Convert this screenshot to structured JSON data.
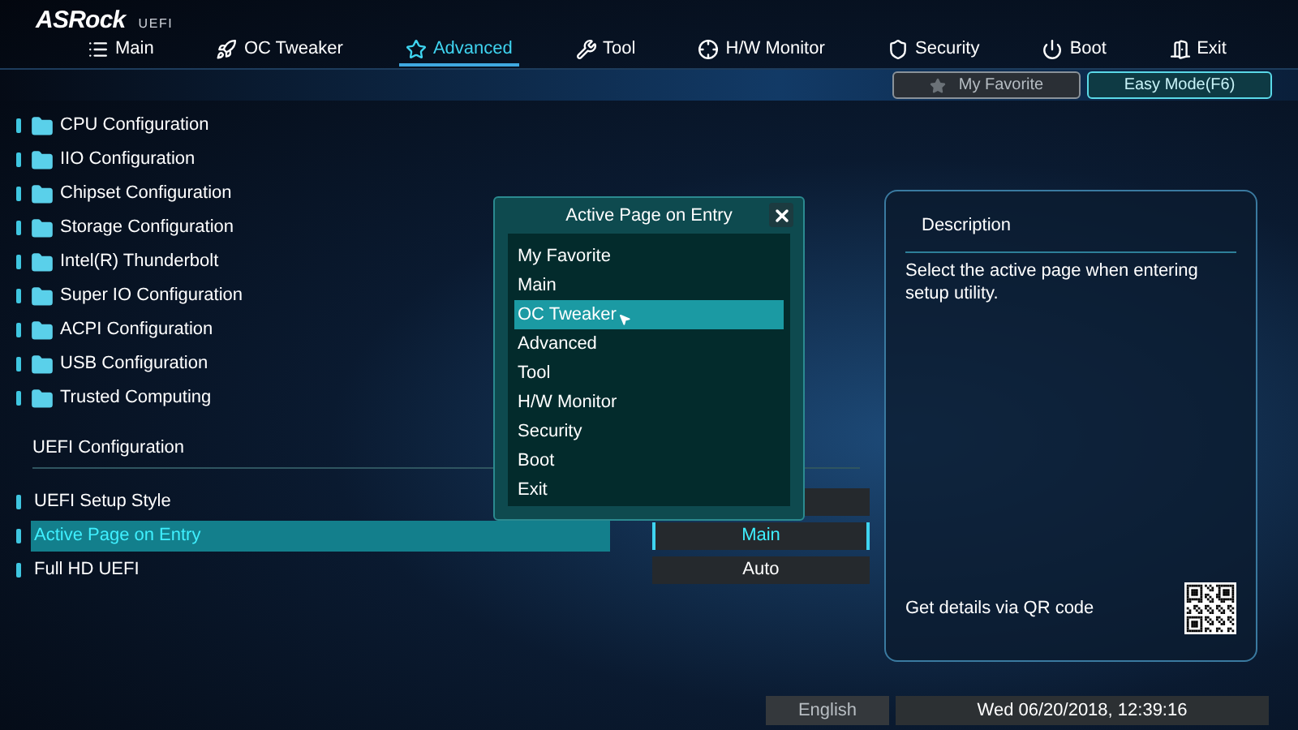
{
  "header": {
    "logo": "ASRock",
    "subtitle": "UEFI"
  },
  "tabs": [
    {
      "label": "Main",
      "selected": false
    },
    {
      "label": "OC Tweaker",
      "selected": false
    },
    {
      "label": "Advanced",
      "selected": true
    },
    {
      "label": "Tool",
      "selected": false
    },
    {
      "label": "H/W Monitor",
      "selected": false
    },
    {
      "label": "Security",
      "selected": false
    },
    {
      "label": "Boot",
      "selected": false
    },
    {
      "label": "Exit",
      "selected": false
    }
  ],
  "toolbar": {
    "favorite": "My Favorite",
    "easy_mode": "Easy Mode(F6)"
  },
  "menu_items": [
    "CPU Configuration",
    "IIO Configuration",
    "Chipset Configuration",
    "Storage Configuration",
    "Intel(R) Thunderbolt",
    "Super IO Configuration",
    "ACPI Configuration",
    "USB Configuration",
    "Trusted Computing"
  ],
  "section_heading": "UEFI Configuration",
  "settings": [
    {
      "label": "UEFI Setup Style",
      "selected": false
    },
    {
      "label": "Active Page on Entry",
      "selected": true,
      "value": "Main"
    },
    {
      "label": "Full HD UEFI",
      "selected": false,
      "value": "Auto"
    }
  ],
  "dialog": {
    "title": "Active Page on Entry",
    "options": [
      {
        "label": "My Favorite",
        "selected": false
      },
      {
        "label": "Main",
        "selected": false
      },
      {
        "label": "OC Tweaker",
        "selected": true
      },
      {
        "label": "Advanced",
        "selected": false
      },
      {
        "label": "Tool",
        "selected": false
      },
      {
        "label": "H/W Monitor",
        "selected": false
      },
      {
        "label": "Security",
        "selected": false
      },
      {
        "label": "Boot",
        "selected": false
      },
      {
        "label": "Exit",
        "selected": false
      }
    ]
  },
  "description": {
    "title": "Description",
    "text": "Select the active page when entering setup utility.",
    "qr_hint": "Get details via QR code"
  },
  "status_bar": {
    "language": "English",
    "datetime": "Wed 06/20/2018, 12:39:16"
  }
}
